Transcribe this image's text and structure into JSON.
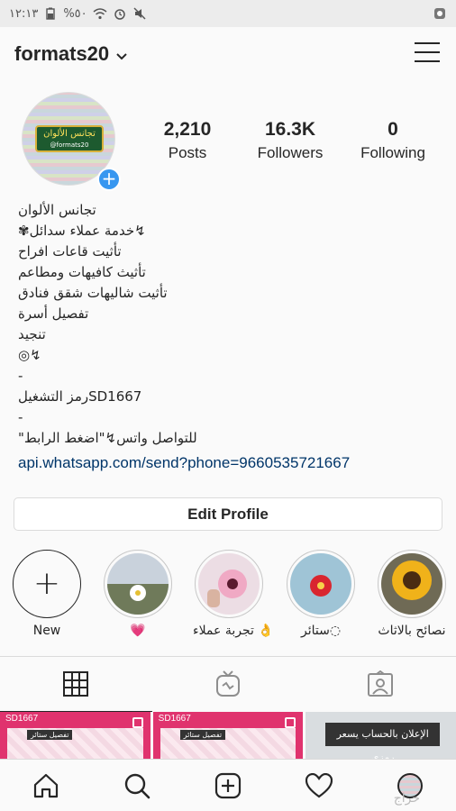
{
  "status_bar": {
    "time": "١٢:١٣",
    "battery": "%٥٠",
    "icons": [
      "battery-icon",
      "wifi-icon",
      "alarm-icon",
      "mute-icon",
      "app-notification-icon"
    ]
  },
  "header": {
    "username": "formats20",
    "chevron_icon": "chevron-down-icon",
    "menu_icon": "hamburger-menu-icon"
  },
  "avatar": {
    "badge_title": "تجانس الألوان",
    "badge_handle": "@formats20",
    "add_icon": "plus-icon"
  },
  "stats": {
    "posts": {
      "value": "2,210",
      "label": "Posts"
    },
    "followers": {
      "value": "16.3K",
      "label": "Followers"
    },
    "following": {
      "value": "0",
      "label": "Following"
    }
  },
  "bio": {
    "lines": [
      "تجانس الألوان",
      "✾خدمة عملاء سدائل↯",
      "تأثيت قاعات افراح",
      "تأثيث كافيهات ومطاعم",
      "تأثيت شاليهات شقق فنادق",
      "تفصيل أسرة",
      "تنجيد",
      "◎↯",
      "-",
      "رمز التشغيلSD1667",
      "-",
      "\"للتواصل واتس↯\"اضغط الرابط"
    ],
    "link": "api.whatsapp.com/send?phone=9660535721667"
  },
  "edit_profile_label": "Edit Profile",
  "highlights": [
    {
      "label": "New",
      "icon": "plus-icon"
    },
    {
      "label": "💗"
    },
    {
      "label": "تجربة عملاء 👌"
    },
    {
      "label": "ستائر◌"
    },
    {
      "label": "نصائح بالاثاث"
    }
  ],
  "tabs": [
    {
      "icon": "grid-icon",
      "active": true
    },
    {
      "icon": "igtv-icon",
      "active": false
    },
    {
      "icon": "tagged-icon",
      "active": false
    }
  ],
  "grid": [
    {
      "tag": "SD1667",
      "tag2": "تفصيل ستائر"
    },
    {
      "tag": "SD1667",
      "tag2": "تفصيل ستائر"
    },
    {
      "banner": "الإعلان بالحساب يسعر رمزي"
    }
  ],
  "bottom_nav": [
    "home-icon",
    "search-icon",
    "new-post-icon",
    "activity-heart-icon",
    "profile-avatar"
  ],
  "watermark": "حراج"
}
